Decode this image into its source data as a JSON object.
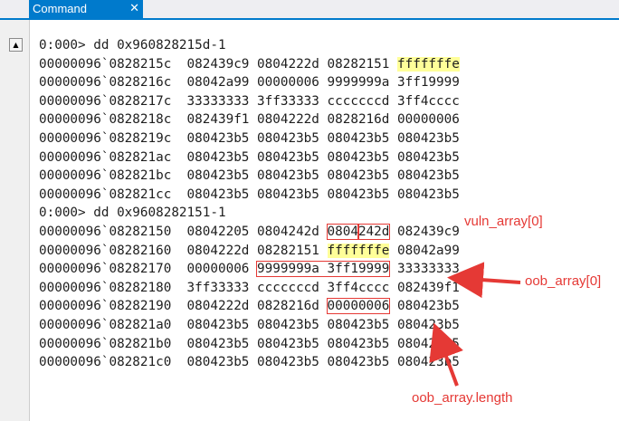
{
  "window": {
    "tab_label": "Command",
    "close_glyph": "✕",
    "scroll_glyph": "▲"
  },
  "console": {
    "dump1": {
      "cmd": "0:000> dd 0x960828215d-1",
      "rows": [
        {
          "addr": "00000096`0828215c",
          "c1": "082439c9",
          "c2": "0804222d",
          "c3": "08282151",
          "c4": "fffffffe"
        },
        {
          "addr": "00000096`0828216c",
          "c1": "08042a99",
          "c2": "00000006",
          "c3": "9999999a",
          "c4": "3ff19999"
        },
        {
          "addr": "00000096`0828217c",
          "c1": "33333333",
          "c2": "3ff33333",
          "c3": "cccccccd",
          "c4": "3ff4cccc"
        },
        {
          "addr": "00000096`0828218c",
          "c1": "082439f1",
          "c2": "0804222d",
          "c3": "0828216d",
          "c4": "00000006"
        },
        {
          "addr": "00000096`0828219c",
          "c1": "080423b5",
          "c2": "080423b5",
          "c3": "080423b5",
          "c4": "080423b5"
        },
        {
          "addr": "00000096`082821ac",
          "c1": "080423b5",
          "c2": "080423b5",
          "c3": "080423b5",
          "c4": "080423b5"
        },
        {
          "addr": "00000096`082821bc",
          "c1": "080423b5",
          "c2": "080423b5",
          "c3": "080423b5",
          "c4": "080423b5"
        },
        {
          "addr": "00000096`082821cc",
          "c1": "080423b5",
          "c2": "080423b5",
          "c3": "080423b5",
          "c4": "080423b5"
        }
      ]
    },
    "dump2": {
      "cmd": "0:000> dd 0x9608282151-1",
      "rows": [
        {
          "addr": "00000096`08282150",
          "c1": "08042205",
          "c2": "0804242d",
          "c3a": "0804",
          "c3b": "242d",
          "c4": "082439c9"
        },
        {
          "addr": "00000096`08282160",
          "c1": "0804222d",
          "c2": "08282151",
          "c3": "fffffffe",
          "c4": "08042a99"
        },
        {
          "addr": "00000096`08282170",
          "c1": "00000006",
          "c2": "9999999a",
          "c3": "3ff19999",
          "c4": "33333333"
        },
        {
          "addr": "00000096`08282180",
          "c1": "3ff33333",
          "c2": "cccccccd",
          "c3": "3ff4cccc",
          "c4": "082439f1"
        },
        {
          "addr": "00000096`08282190",
          "c1": "0804222d",
          "c2": "0828216d",
          "c3": "00000006",
          "c4": "080423b5"
        },
        {
          "addr": "00000096`082821a0",
          "c1": "080423b5",
          "c2": "080423b5",
          "c3": "080423b5",
          "c4": "080423b5"
        },
        {
          "addr": "00000096`082821b0",
          "c1": "080423b5",
          "c2": "080423b5",
          "c3": "080423b5",
          "c4": "080423b5"
        },
        {
          "addr": "00000096`082821c0",
          "c1": "080423b5",
          "c2": "080423b5",
          "c3": "080423b5",
          "c4": "080423b5"
        }
      ]
    }
  },
  "annotations": {
    "vuln_array": "vuln_array[0]",
    "oob_array": "oob_array[0]",
    "oob_length": "oob_array.length",
    "color": "#e53935"
  }
}
